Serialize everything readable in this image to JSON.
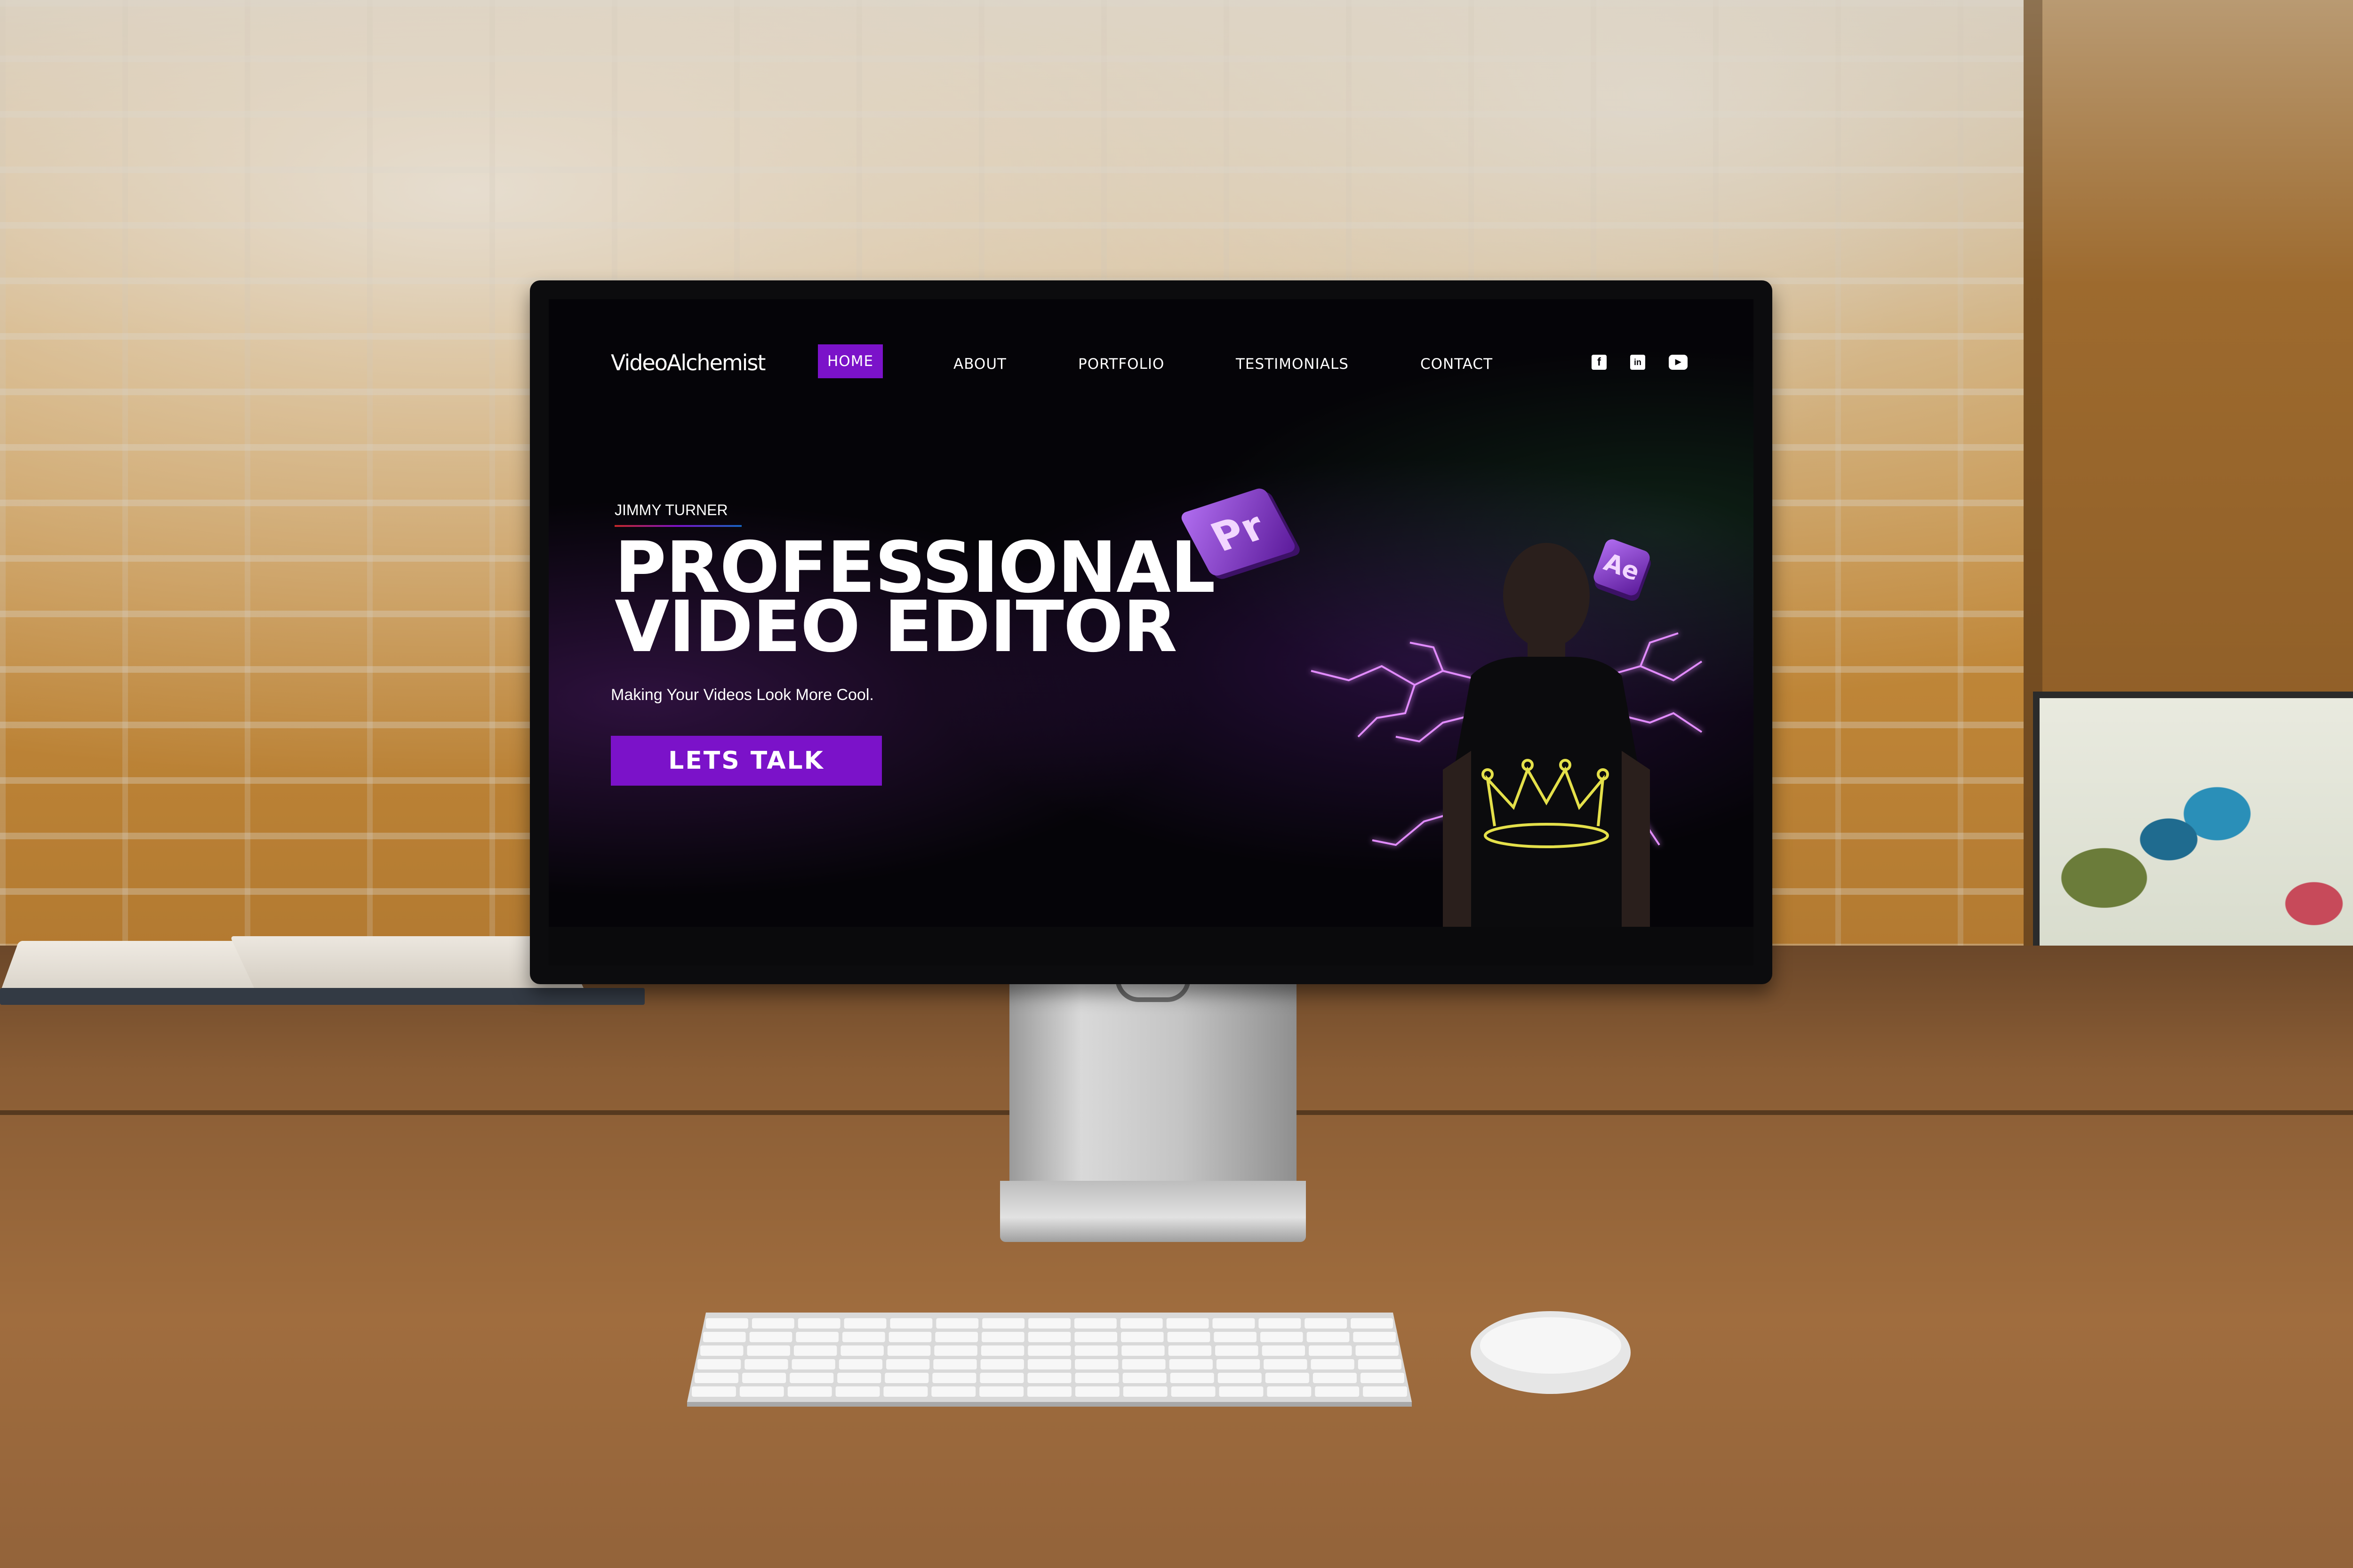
{
  "site": {
    "logo": "VideoAlchemist",
    "nav": [
      {
        "label": "HOME",
        "active": true
      },
      {
        "label": "ABOUT",
        "active": false
      },
      {
        "label": "PORTFOLIO",
        "active": false
      },
      {
        "label": "TESTIMONIALS",
        "active": false
      },
      {
        "label": "CONTACT",
        "active": false
      }
    ],
    "social": [
      {
        "icon": "facebook-icon",
        "glyph": "f"
      },
      {
        "icon": "linkedin-icon",
        "glyph": "in"
      },
      {
        "icon": "youtube-icon",
        "glyph": "▶"
      }
    ],
    "hero": {
      "name": "JIMMY TURNER",
      "title_line1": "PROFESSIONAL",
      "title_line2": "VIDEO EDITOR",
      "subtitle": "Making Your Videos Look More Cool.",
      "cta_label": "LETS TALK"
    },
    "badges": {
      "premiere": "Pr",
      "after_effects": "Ae"
    }
  },
  "colors": {
    "accent": "#7b12c9",
    "background": "#050408",
    "text": "#ffffff",
    "crown": "#e4e04a",
    "lightning": "#e28cff"
  }
}
